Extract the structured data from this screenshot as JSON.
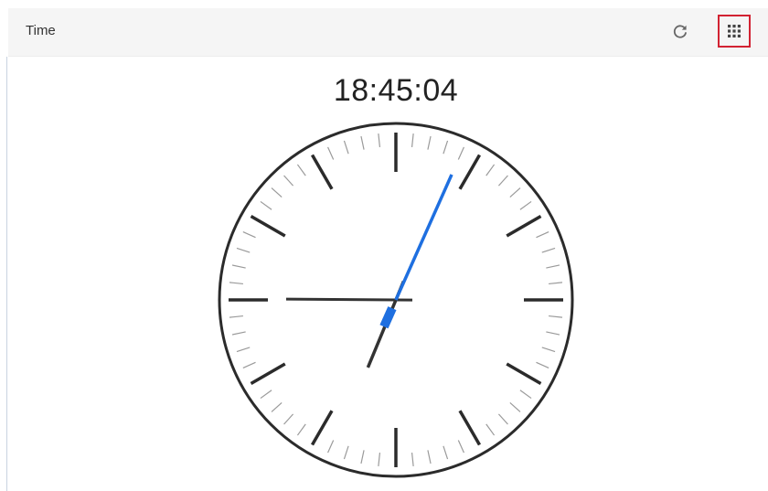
{
  "header": {
    "title": "Time",
    "refresh_icon": "refresh-icon",
    "apps_icon": "apps-grid-icon",
    "highlight_color": "#d22232"
  },
  "clock": {
    "digital_time": "18:45:04",
    "hour": 18,
    "minute": 45,
    "second": 4,
    "second_hand_color": "#1e6fe0",
    "hand_color": "#333333"
  }
}
